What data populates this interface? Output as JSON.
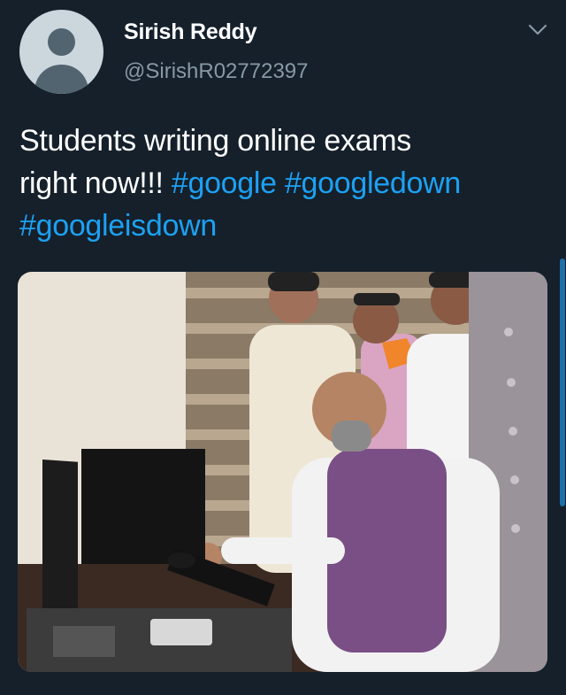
{
  "user": {
    "name": "Sirish Reddy",
    "handle": "@SirishR02772397"
  },
  "tweet": {
    "text_line1": "Students writing online exams",
    "text_prefix2": "right now!!! ",
    "tag1": "#google",
    "tag2": "#googledown",
    "tag3": "#googleisdown"
  },
  "colors": {
    "background": "#15202b",
    "handle": "#8899a6",
    "link": "#1da1f2"
  },
  "icons": {
    "more": "chevron-down-icon",
    "avatar": "default-avatar-icon"
  }
}
